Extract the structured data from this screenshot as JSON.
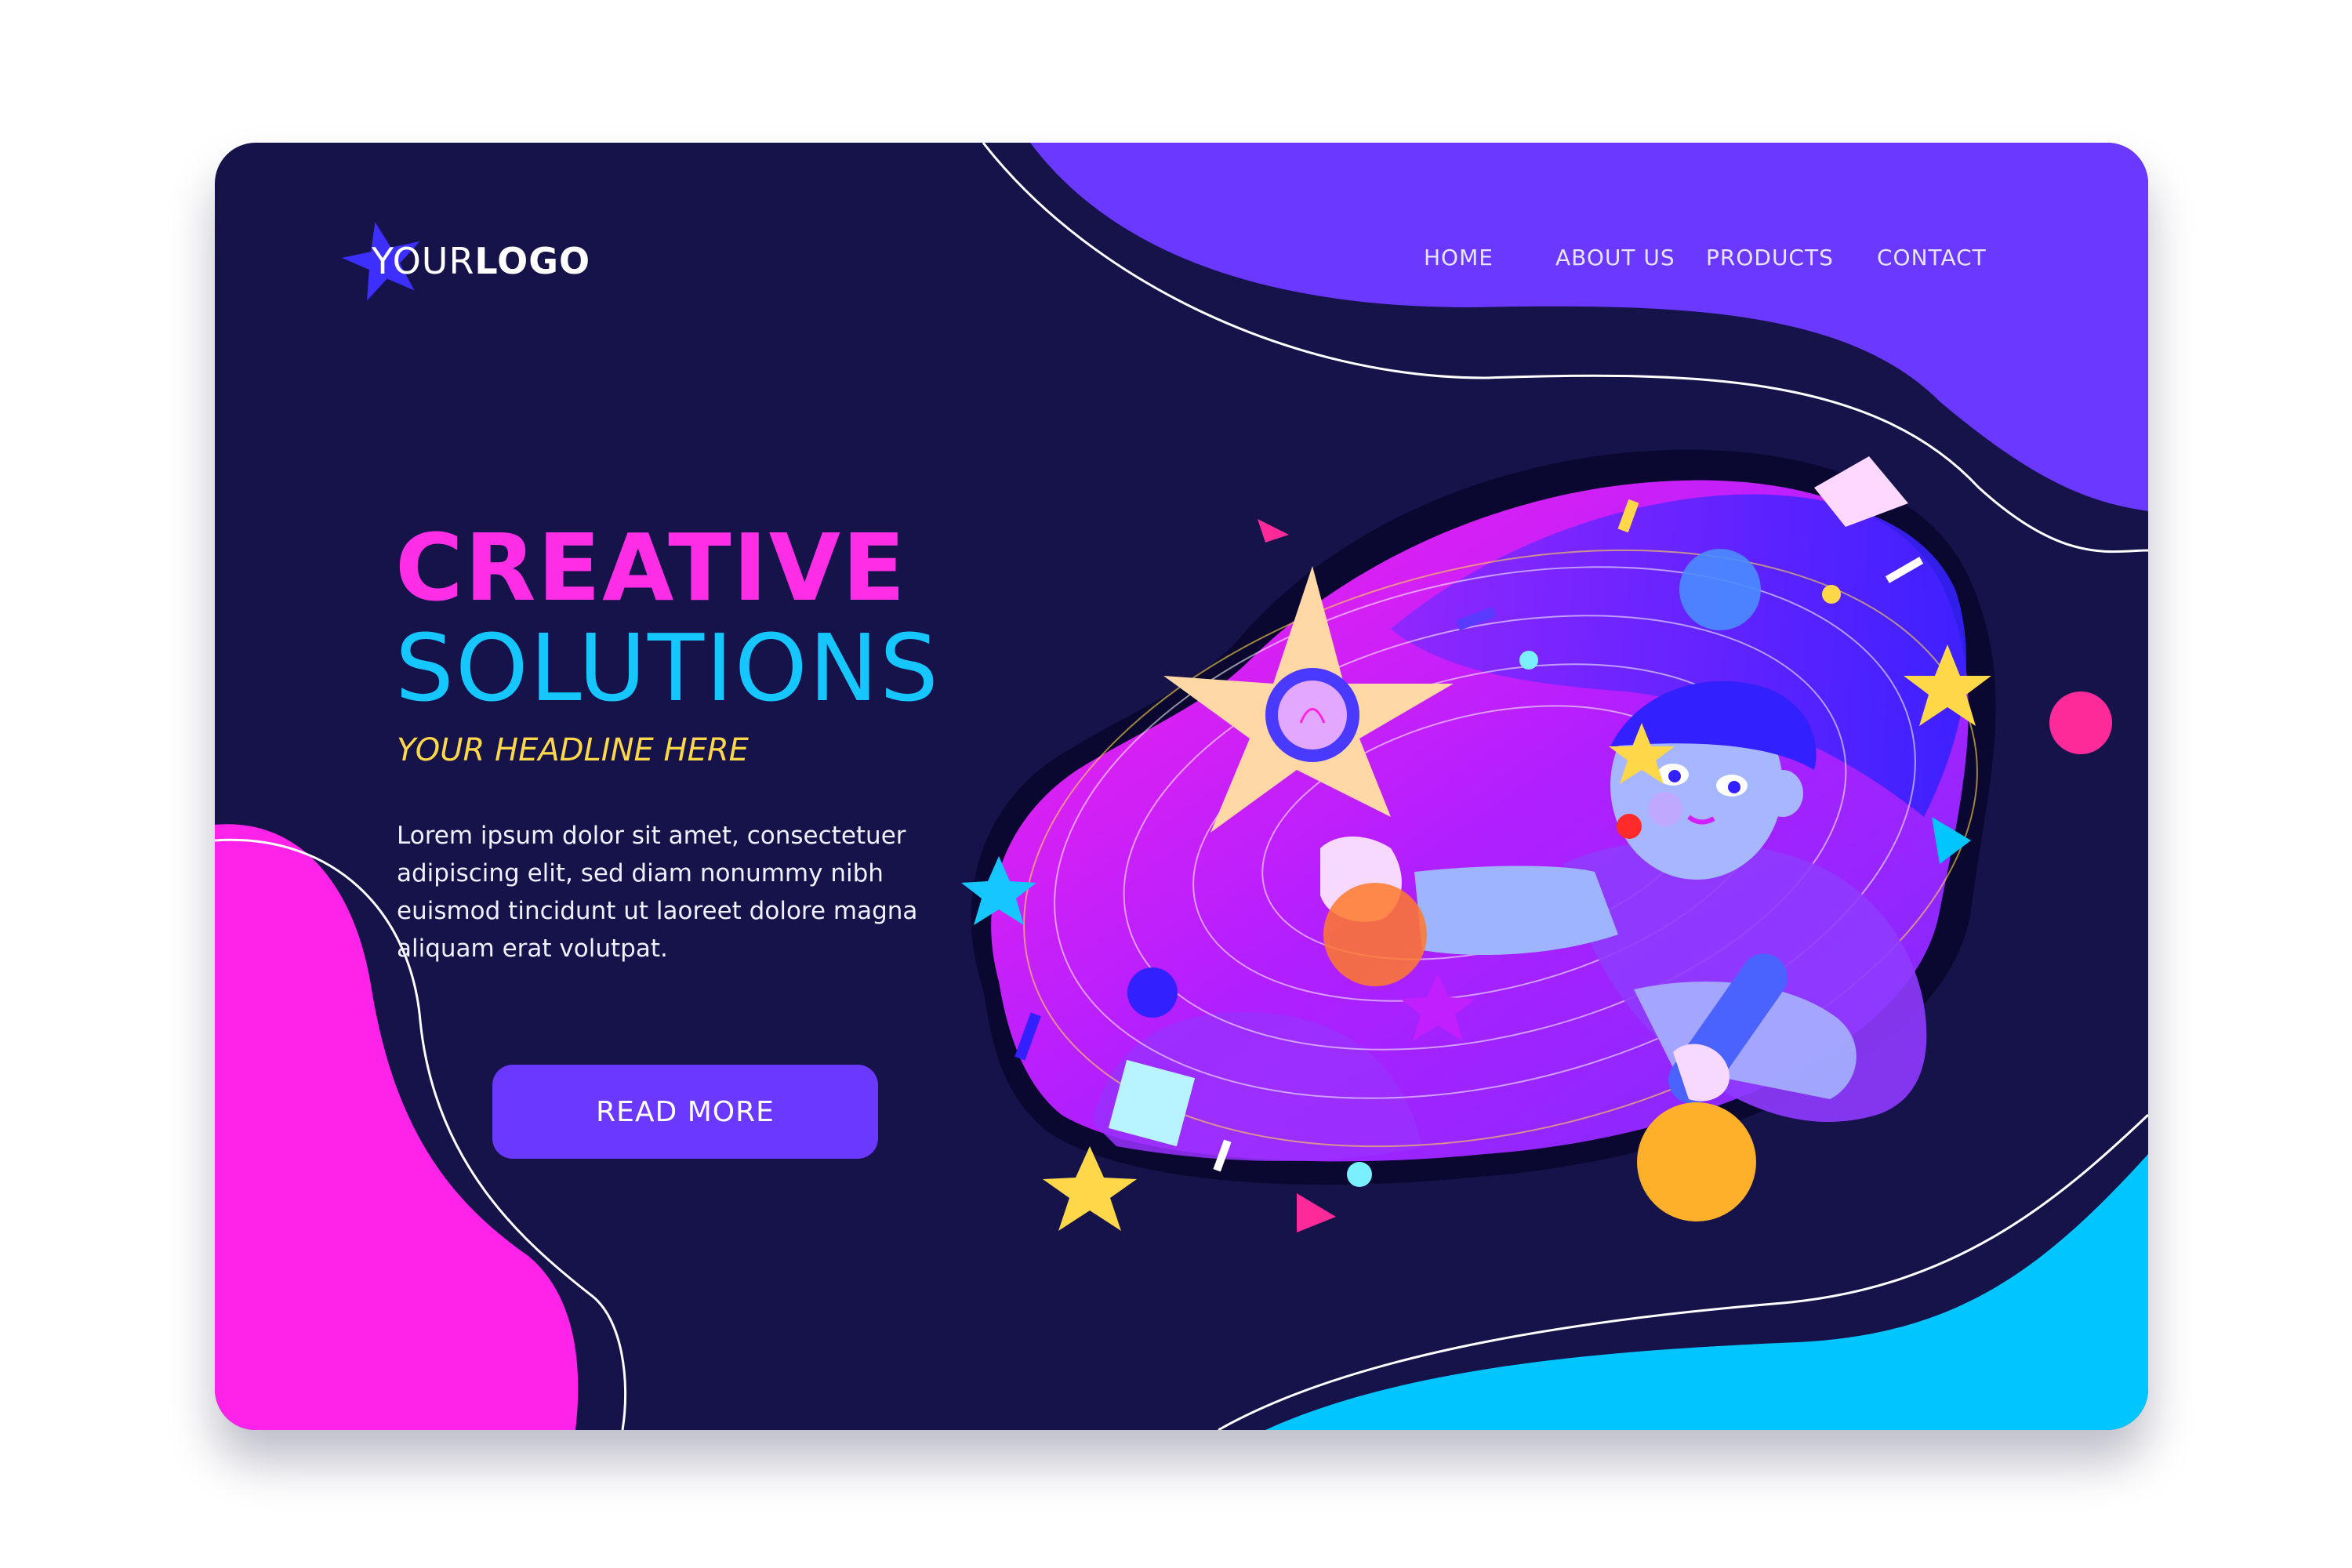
{
  "logo": {
    "text_light": "YOUR",
    "text_bold": "LOGO"
  },
  "nav": {
    "items": [
      {
        "label": "HOME"
      },
      {
        "label": "ABOUT US"
      },
      {
        "label": "PRODUCTS"
      },
      {
        "label": "CONTACT"
      }
    ]
  },
  "hero": {
    "title_line1": "CREATIVE",
    "title_line2": "SOLUTIONS",
    "headline": "YOUR HEADLINE HERE",
    "body": "Lorem ipsum dolor sit amet, consectetuer adipiscing elit, sed diam nonummy nibh euismod tincidunt ut laoreet dolore magna aliquam erat volutpat.",
    "button_label": "READ MORE"
  },
  "colors": {
    "background": "#15134a",
    "accent_purple": "#6a38ff",
    "accent_pink": "#ff22e8",
    "accent_cyan": "#00c6ff",
    "headline_yellow": "#ffd84a"
  },
  "icons": {
    "logo": "star-icon"
  }
}
